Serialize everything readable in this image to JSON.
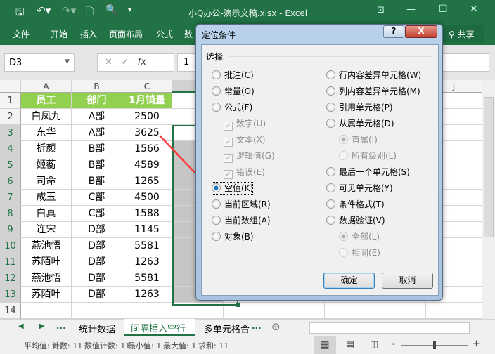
{
  "title": "小Q办公-演示文稿.xlsx - Excel",
  "ribbon": {
    "tabs": [
      "文件",
      "开始",
      "插入",
      "页面布局",
      "公式",
      "数"
    ],
    "share": "共享"
  },
  "formula_bar": {
    "name_box": "D3",
    "value": "1",
    "fx": "fx"
  },
  "columns": [
    "A",
    "B",
    "C",
    "D",
    "",
    "",
    "",
    "",
    "J"
  ],
  "rows": [
    [
      "员工",
      "部门",
      "1月销量"
    ],
    [
      "白凤九",
      "A部",
      "2500"
    ],
    [
      "东华",
      "A部",
      "3625"
    ],
    [
      "折颜",
      "B部",
      "1566"
    ],
    [
      "姬蘅",
      "B部",
      "4589"
    ],
    [
      "司命",
      "B部",
      "1265"
    ],
    [
      "成玉",
      "C部",
      "4500"
    ],
    [
      "白真",
      "C部",
      "1588"
    ],
    [
      "连宋",
      "D部",
      "1145"
    ],
    [
      "燕池悟",
      "D部",
      "5581"
    ],
    [
      "苏陌叶",
      "D部",
      "1263"
    ],
    [
      "燕池悟",
      "D部",
      "5581"
    ],
    [
      "苏陌叶",
      "D部",
      "1263"
    ],
    [
      "",
      "",
      ""
    ]
  ],
  "dialog": {
    "title": "定位条件",
    "help": "?",
    "close": "X",
    "group": "选择",
    "left": [
      {
        "label": "批注(C)",
        "type": "radio",
        "state": "off"
      },
      {
        "label": "常量(O)",
        "type": "radio",
        "state": "off"
      },
      {
        "label": "公式(F)",
        "type": "radio",
        "state": "off"
      },
      {
        "label": "数字(U)",
        "type": "check",
        "state": "dis"
      },
      {
        "label": "文本(X)",
        "type": "check",
        "state": "dis"
      },
      {
        "label": "逻辑值(G)",
        "type": "check",
        "state": "dis"
      },
      {
        "label": "错误(E)",
        "type": "check",
        "state": "dis"
      },
      {
        "label": "空值(K)",
        "type": "radio",
        "state": "on"
      },
      {
        "label": "当前区域(R)",
        "type": "radio",
        "state": "off"
      },
      {
        "label": "当前数组(A)",
        "type": "radio",
        "state": "off"
      },
      {
        "label": "对象(B)",
        "type": "radio",
        "state": "off"
      }
    ],
    "right": [
      {
        "label": "行内容差异单元格(W)",
        "type": "radio",
        "state": "off"
      },
      {
        "label": "列内容差异单元格(M)",
        "type": "radio",
        "state": "off"
      },
      {
        "label": "引用单元格(P)",
        "type": "radio",
        "state": "off"
      },
      {
        "label": "从属单元格(D)",
        "type": "radio",
        "state": "off"
      },
      {
        "label": "直属(I)",
        "type": "radio",
        "state": "dison",
        "sub": true
      },
      {
        "label": "所有级别(L)",
        "type": "radio",
        "state": "disoff",
        "sub": true
      },
      {
        "label": "最后一个单元格(S)",
        "type": "radio",
        "state": "off"
      },
      {
        "label": "可见单元格(Y)",
        "type": "radio",
        "state": "off"
      },
      {
        "label": "条件格式(T)",
        "type": "radio",
        "state": "off"
      },
      {
        "label": "数据验证(V)",
        "type": "radio",
        "state": "off"
      },
      {
        "label": "全部(L)",
        "type": "radio",
        "state": "dison",
        "sub": true
      },
      {
        "label": "相同(E)",
        "type": "radio",
        "state": "disoff",
        "sub": true
      }
    ],
    "ok": "确定",
    "cancel": "取消"
  },
  "sheets": {
    "tabs": [
      "统计数据",
      "间隔插入空行",
      "多单元格合"
    ],
    "active": 1,
    "more": "..."
  },
  "status": {
    "items": [
      "平均值: 1",
      "计数: 11",
      "数值计数: 11",
      "最小值: 1",
      "最大值: 1",
      "求和: 11"
    ]
  },
  "colors": {
    "excel_green": "#217346",
    "header_fill": "#92d050",
    "arrow": "#ff3b3b"
  }
}
